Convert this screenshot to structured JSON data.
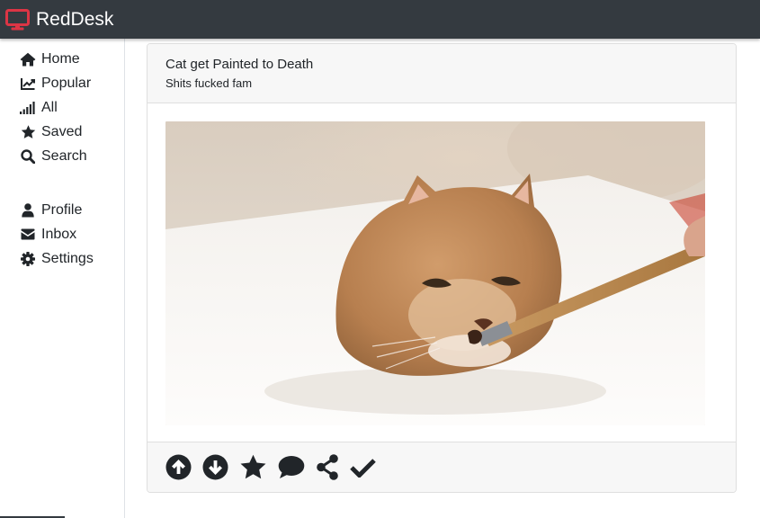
{
  "app": {
    "brand_name": "RedDesk",
    "brand_color": "#dc3545",
    "navbar_color": "#343a40",
    "brand_icon": "desktop-icon"
  },
  "sidebar": {
    "primary_items": [
      {
        "label": "Home",
        "icon": "home-icon"
      },
      {
        "label": "Popular",
        "icon": "chart-line-icon"
      },
      {
        "label": "All",
        "icon": "signal-icon"
      },
      {
        "label": "Saved",
        "icon": "star-icon"
      },
      {
        "label": "Search",
        "icon": "search-icon"
      }
    ],
    "secondary_items": [
      {
        "label": "Profile",
        "icon": "user-icon"
      },
      {
        "label": "Inbox",
        "icon": "envelope-icon"
      },
      {
        "label": "Settings",
        "icon": "gear-icon"
      }
    ]
  },
  "post": {
    "title": "Cat get Painted to Death",
    "subtitle": "Shits fucked fam",
    "image_subject": "cat-photo",
    "actions": [
      {
        "name": "upvote",
        "icon": "arrow-circle-up-icon"
      },
      {
        "name": "downvote",
        "icon": "arrow-circle-down-icon"
      },
      {
        "name": "save",
        "icon": "star-icon"
      },
      {
        "name": "comment",
        "icon": "comment-icon"
      },
      {
        "name": "share",
        "icon": "share-icon"
      },
      {
        "name": "mark-read",
        "icon": "check-icon"
      }
    ]
  }
}
